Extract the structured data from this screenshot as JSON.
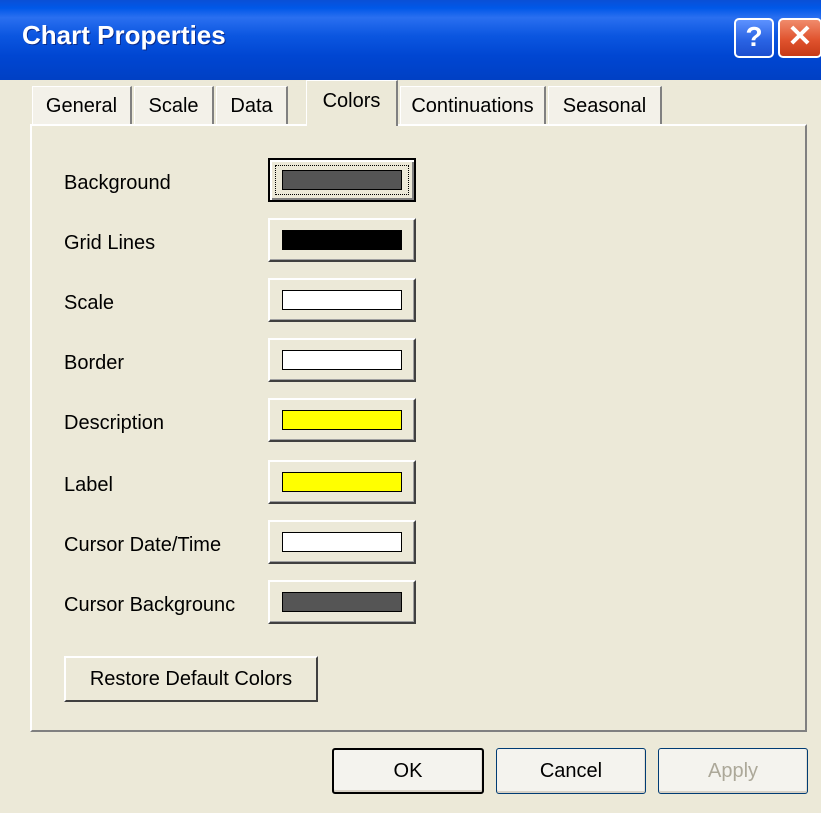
{
  "window": {
    "title": "Chart Properties"
  },
  "tabs": [
    {
      "label": "General"
    },
    {
      "label": "Scale"
    },
    {
      "label": "Data"
    },
    {
      "label": "Colors",
      "active": true
    },
    {
      "label": "Continuations"
    },
    {
      "label": "Seasonal"
    }
  ],
  "colors": {
    "items": [
      {
        "label": "Background",
        "color": "#555555"
      },
      {
        "label": "Grid Lines",
        "color": "#000000"
      },
      {
        "label": "Scale",
        "color": "#ffffff"
      },
      {
        "label": "Border",
        "color": "#ffffff"
      },
      {
        "label": "Description",
        "color": "#ffff00"
      },
      {
        "label": "Label",
        "color": "#ffff00"
      },
      {
        "label": "Cursor Date/Time",
        "color": "#ffffff"
      },
      {
        "label": "Cursor Backgrounc",
        "color": "#555555"
      }
    ],
    "restore_label": "Restore Default Colors"
  },
  "footer": {
    "ok_label": "OK",
    "cancel_label": "Cancel",
    "apply_label": "Apply"
  }
}
